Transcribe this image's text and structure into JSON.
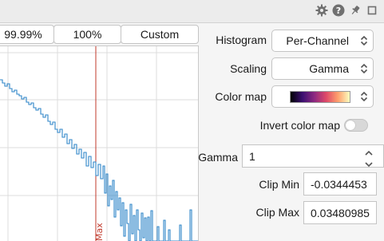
{
  "toolbar": {
    "percent_buttons": [
      "99.99%",
      "100%",
      "Custom"
    ]
  },
  "window_controls": {
    "icons": [
      "gear-icon",
      "help-icon",
      "pin-icon",
      "maximize-icon"
    ]
  },
  "settings": {
    "histogram_label": "Histogram",
    "histogram_value": "Per-Channel",
    "scaling_label": "Scaling",
    "scaling_value": "Gamma",
    "colormap_label": "Color map",
    "invert_label": "Invert color map",
    "invert_on": false,
    "gamma_label": "Gamma",
    "gamma_value": "1",
    "clip_min_label": "Clip Min",
    "clip_min_value": "-0.0344453",
    "clip_max_label": "Clip Max",
    "clip_max_value": "0.03480985"
  },
  "plot": {
    "marker_label": "Max",
    "line_color": "#2f86c8",
    "marker_color": "#c0392b"
  },
  "colors": {
    "colormap": [
      "#000004",
      "#3b0f70",
      "#8c2981",
      "#de4968",
      "#fe9f6d",
      "#fcfdbf"
    ]
  }
}
